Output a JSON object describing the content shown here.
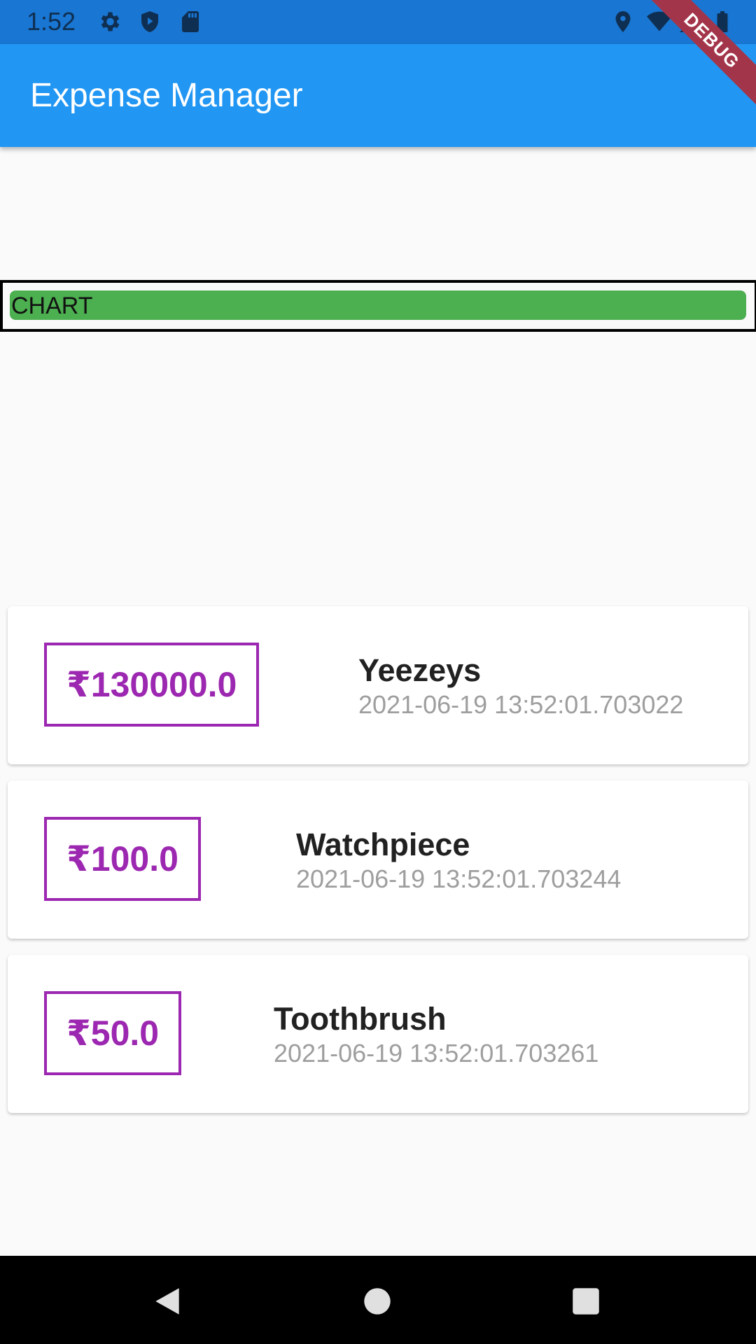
{
  "status_bar": {
    "time": "1:52",
    "icons": [
      "gear-icon",
      "shield-play-icon",
      "sd-card-icon",
      "location-icon",
      "wifi-icon",
      "signal-icon",
      "battery-icon"
    ]
  },
  "app_bar": {
    "title": "Expense Manager"
  },
  "debug_banner": {
    "label": "DEBUG",
    "color": "#a3354a"
  },
  "chart": {
    "label": "CHART",
    "fill_fraction": 1.0,
    "fill_color": "#4caf50"
  },
  "transactions": [
    {
      "amount": "₹130000.0",
      "title": "Yeezeys",
      "date": "2021-06-19 13:52:01.703022"
    },
    {
      "amount": "₹100.0",
      "title": "Watchpiece",
      "date": "2021-06-19 13:52:01.703244"
    },
    {
      "amount": "₹50.0",
      "title": "Toothbrush",
      "date": "2021-06-19 13:52:01.703261"
    }
  ],
  "nav_bar": {
    "buttons": [
      "back-icon",
      "home-icon",
      "recents-icon"
    ]
  },
  "colors": {
    "primary": "#2196f3",
    "status_bar": "#1976d2",
    "accent": "#9c27b0"
  }
}
